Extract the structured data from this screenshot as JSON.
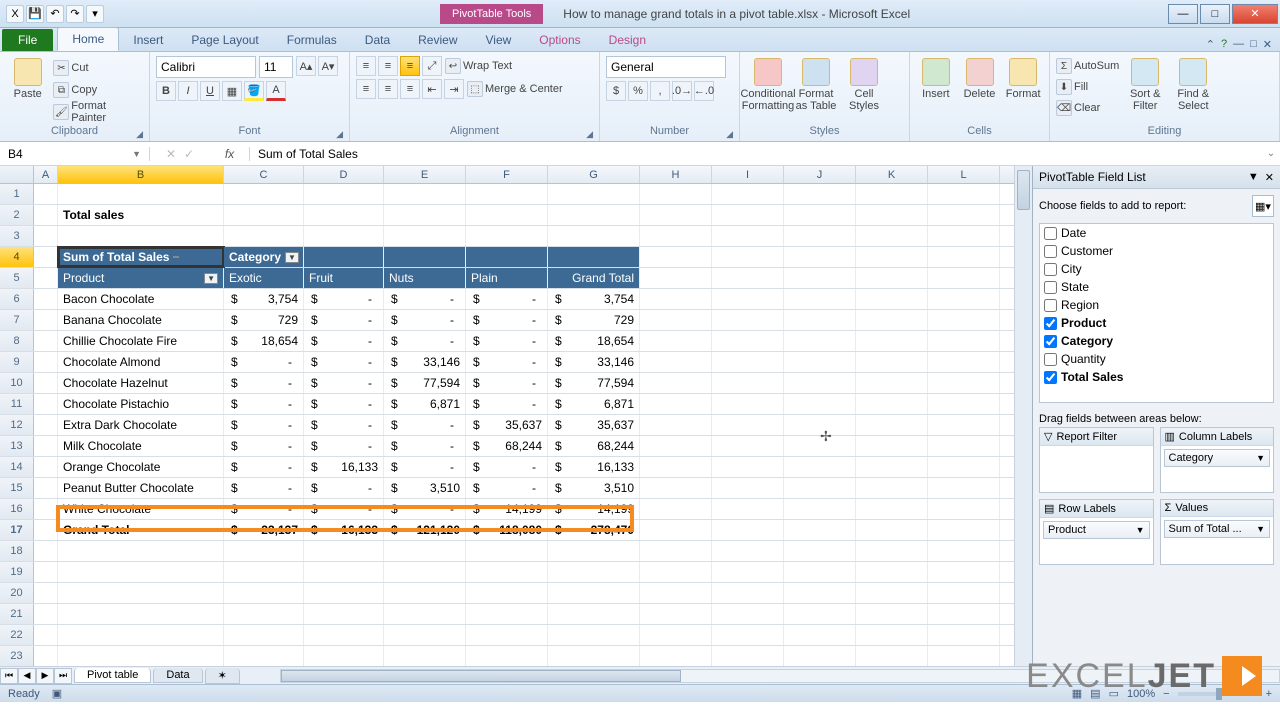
{
  "title": {
    "pivottools": "PivotTable Tools",
    "doc": "How to manage grand totals in a pivot table.xlsx - Microsoft Excel"
  },
  "tabs": {
    "file": "File",
    "home": "Home",
    "insert": "Insert",
    "pagelayout": "Page Layout",
    "formulas": "Formulas",
    "data": "Data",
    "review": "Review",
    "view": "View",
    "options": "Options",
    "design": "Design"
  },
  "ribbon": {
    "paste": "Paste",
    "cut": "Cut",
    "copy": "Copy",
    "fmtpainter": "Format Painter",
    "clipboard": "Clipboard",
    "font": "Font",
    "fontname": "Calibri",
    "fontsize": "11",
    "alignment": "Alignment",
    "wrap": "Wrap Text",
    "merge": "Merge & Center",
    "number": "Number",
    "numfmt": "General",
    "styles": "Styles",
    "cond": "Conditional Formatting",
    "fmtastable": "Format as Table",
    "cellstyles": "Cell Styles",
    "cells": "Cells",
    "ins": "Insert",
    "del": "Delete",
    "fmt": "Format",
    "editing": "Editing",
    "autosum": "AutoSum",
    "fill": "Fill",
    "clear": "Clear",
    "sort": "Sort & Filter",
    "find": "Find & Select"
  },
  "formula": {
    "cell": "B4",
    "value": "Sum of Total Sales"
  },
  "cols": [
    "A",
    "B",
    "C",
    "D",
    "E",
    "F",
    "G",
    "H",
    "I",
    "J",
    "K",
    "L"
  ],
  "pivot": {
    "title": "Total sales",
    "sumlabel": "Sum of Total Sales",
    "category": "Category",
    "product": "Product",
    "headers": [
      "Exotic",
      "Fruit",
      "Nuts",
      "Plain",
      "Grand Total"
    ],
    "rows": [
      {
        "p": "Bacon Chocolate",
        "v": [
          "3,754",
          "-",
          "-",
          "-",
          "3,754"
        ]
      },
      {
        "p": "Banana Chocolate",
        "v": [
          "729",
          "-",
          "-",
          "-",
          "729"
        ]
      },
      {
        "p": "Chillie Chocolate Fire",
        "v": [
          "18,654",
          "-",
          "-",
          "-",
          "18,654"
        ]
      },
      {
        "p": "Chocolate Almond",
        "v": [
          "-",
          "-",
          "33,146",
          "-",
          "33,146"
        ]
      },
      {
        "p": "Chocolate Hazelnut",
        "v": [
          "-",
          "-",
          "77,594",
          "-",
          "77,594"
        ]
      },
      {
        "p": "Chocolate Pistachio",
        "v": [
          "-",
          "-",
          "6,871",
          "-",
          "6,871"
        ]
      },
      {
        "p": "Extra Dark Chocolate",
        "v": [
          "-",
          "-",
          "-",
          "35,637",
          "35,637"
        ]
      },
      {
        "p": "Milk Chocolate",
        "v": [
          "-",
          "-",
          "-",
          "68,244",
          "68,244"
        ]
      },
      {
        "p": "Orange Chocolate",
        "v": [
          "-",
          "16,133",
          "-",
          "-",
          "16,133"
        ]
      },
      {
        "p": "Peanut Butter Chocolate",
        "v": [
          "-",
          "-",
          "3,510",
          "-",
          "3,510"
        ]
      },
      {
        "p": "White Chocolate",
        "v": [
          "-",
          "-",
          "-",
          "14,199",
          "14,199"
        ]
      }
    ],
    "grandtotal": {
      "label": "Grand Total",
      "v": [
        "23,137",
        "16,133",
        "121,120",
        "118,080",
        "278,470"
      ]
    }
  },
  "pane": {
    "title": "PivotTable Field List",
    "choose": "Choose fields to add to report:",
    "fields": [
      {
        "n": "Date",
        "c": false
      },
      {
        "n": "Customer",
        "c": false
      },
      {
        "n": "City",
        "c": false
      },
      {
        "n": "State",
        "c": false
      },
      {
        "n": "Region",
        "c": false
      },
      {
        "n": "Product",
        "c": true
      },
      {
        "n": "Category",
        "c": true
      },
      {
        "n": "Quantity",
        "c": false
      },
      {
        "n": "Total Sales",
        "c": true
      }
    ],
    "drag": "Drag fields between areas below:",
    "areas": {
      "filter": "Report Filter",
      "cols": "Column Labels",
      "rows": "Row Labels",
      "vals": "Values",
      "rowitem": "Product",
      "colitem": "Category",
      "valitem": "Sum of Total ..."
    }
  },
  "sheets": {
    "t1": "Pivot table",
    "t2": "Data"
  },
  "status": {
    "ready": "Ready",
    "zoom": "100%"
  },
  "wm": {
    "a": "EXCEL",
    "b": "JET"
  }
}
